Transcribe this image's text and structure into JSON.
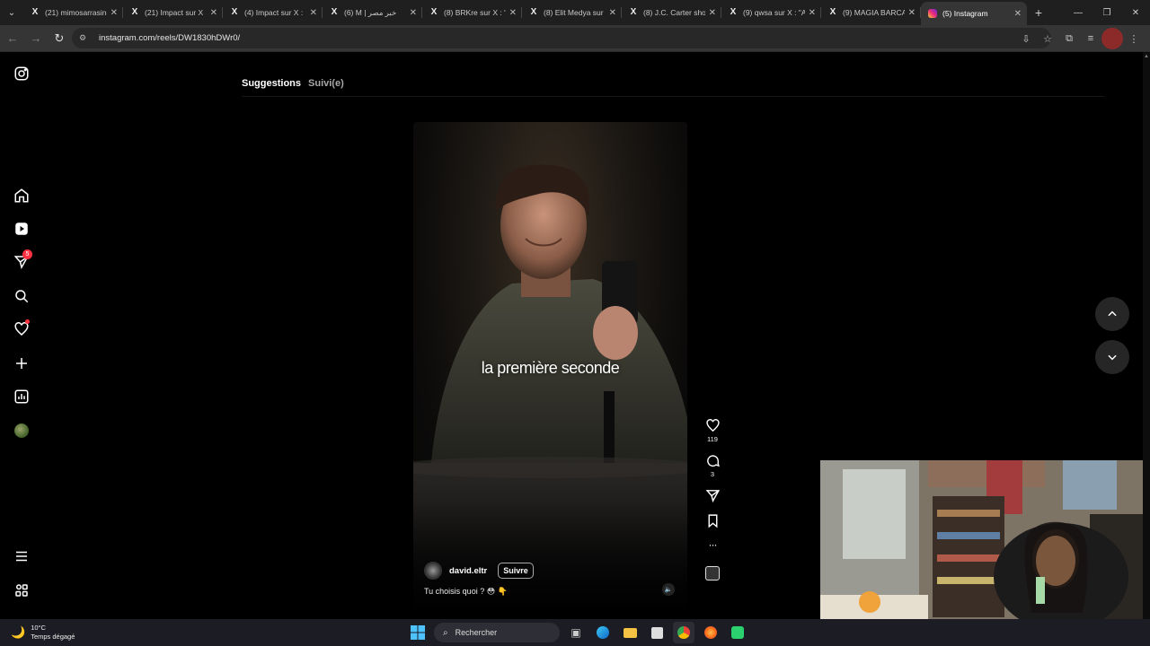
{
  "browser": {
    "tabs": [
      {
        "title": "(21) mimosarrasine",
        "favicon": "x-icon"
      },
      {
        "title": "(21) Impact sur X",
        "favicon": "x-icon"
      },
      {
        "title": "(4) Impact sur X :",
        "favicon": "x-icon"
      },
      {
        "title": "(6) M | خبر مصر",
        "favicon": "x-icon"
      },
      {
        "title": "(8) BRKre sur X : \"",
        "favicon": "x-icon"
      },
      {
        "title": "(8) Elit Medya sur",
        "favicon": "x-icon"
      },
      {
        "title": "(8) J.C. Carter sho",
        "favicon": "x-icon"
      },
      {
        "title": "(9) qwsa sur X : \"A",
        "favicon": "x-icon"
      },
      {
        "title": "(9) MAGIA BARCA",
        "favicon": "x-icon"
      },
      {
        "title": "(5) Instagram",
        "favicon": "instagram-icon",
        "active": true
      }
    ],
    "x_glyph": "X",
    "url": "instagram.com/reels/DW1830hDWr0/"
  },
  "sidebar": {
    "notifications_badge": "5"
  },
  "feed": {
    "tab_suggestions": "Suggestions",
    "tab_following": "Suivi(e)"
  },
  "reel": {
    "overlay_text": "la première seconde",
    "author": "david.eltr",
    "follow_label": "Suivre",
    "caption": "Tu choisis quoi ? 😳 👇",
    "likes": "119",
    "comments": "3",
    "more": "···"
  },
  "taskbar": {
    "temperature": "10°C",
    "weather": "Temps dégagé",
    "search_placeholder": "Rechercher"
  },
  "colors": {
    "badge": "#ff3040",
    "page_bg": "#000000",
    "tab_strip": "#1f1f1f",
    "toolbar": "#353535"
  }
}
